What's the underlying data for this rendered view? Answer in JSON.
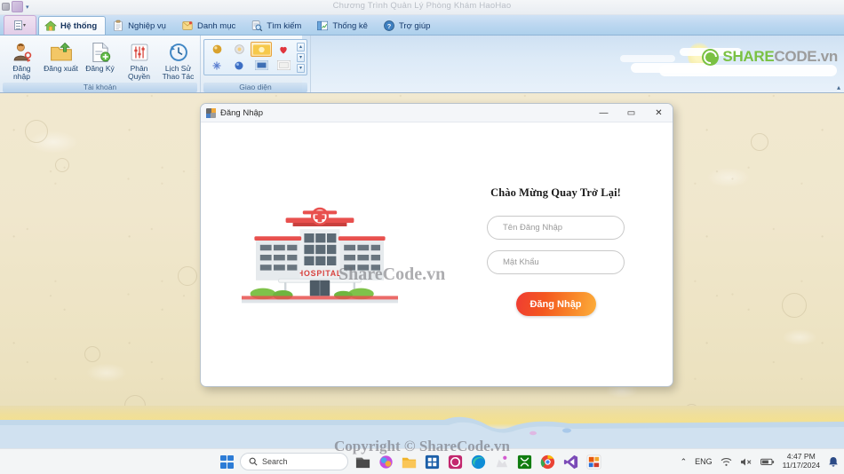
{
  "window": {
    "title": "Chương Trình Quản Lý Phòng Khám HaoHao",
    "quick_access": [
      "save-icon",
      "undo-icon",
      "customize-caret"
    ]
  },
  "ribbon": {
    "app_button": "file-menu-button",
    "tabs": [
      {
        "label": "Hệ thống",
        "icon": "home-icon",
        "active": true
      },
      {
        "label": "Nghiệp vụ",
        "icon": "clipboard-icon",
        "active": false
      },
      {
        "label": "Danh  mục",
        "icon": "notes-icon",
        "active": false
      },
      {
        "label": "Tìm kiếm",
        "icon": "magnifier-icon",
        "active": false
      },
      {
        "label": "Thống kê",
        "icon": "chart-book-icon",
        "active": false
      },
      {
        "label": "Trợ giúp",
        "icon": "help-icon",
        "active": false
      }
    ],
    "groups": [
      {
        "label": "Tài khoản",
        "buttons": [
          {
            "label": "Đăng nhập",
            "icon": "user-key-icon"
          },
          {
            "label": "Đăng xuất",
            "icon": "folder-out-icon"
          },
          {
            "label": "Đăng Ký",
            "icon": "page-add-icon"
          },
          {
            "label": "Phân Quyền",
            "icon": "permissions-icon"
          },
          {
            "label": "Lịch Sử\nThao Tác",
            "icon": "history-icon"
          }
        ]
      },
      {
        "label": "Giao diện",
        "swatches": [
          {
            "name": "theme-amber-sphere",
            "selected": false
          },
          {
            "name": "theme-grey-flower",
            "selected": false
          },
          {
            "name": "theme-gold-bar",
            "selected": true
          },
          {
            "name": "theme-red-heart",
            "selected": false
          },
          {
            "name": "theme-blue-snow",
            "selected": false
          },
          {
            "name": "theme-blue-sphere",
            "selected": false
          },
          {
            "name": "theme-blue-square",
            "selected": false
          },
          {
            "name": "theme-white-frame",
            "selected": false
          }
        ],
        "scroll_up": "▴",
        "scroll_down": "▾",
        "scroll_more": "▾"
      }
    ],
    "collapse_icon": "▴",
    "brand": {
      "mark": "sharecode-logo-icon",
      "part_a": "SHARE",
      "part_b": "CODE.vn"
    }
  },
  "dialog": {
    "title": "Đăng Nhập",
    "icon": "app-window-icon",
    "controls": {
      "minimize": "—",
      "maximize": "▭",
      "close": "✕"
    },
    "illustration": "hospital-building-icon",
    "welcome": "Chào Mừng Quay Trở Lại!",
    "username": {
      "placeholder": "Tên Đăng Nhập",
      "value": "",
      "icon": "user-icon"
    },
    "password": {
      "placeholder": "Mật Khẩu",
      "value": "",
      "icon": "lock-icon"
    },
    "submit_label": "Đăng Nhập",
    "watermark": "ShareCode.vn"
  },
  "taskbar": {
    "start": "windows-start-icon",
    "search_placeholder": "Search",
    "search_icon": "search-icon",
    "apps": [
      {
        "name": "file-explorer-icon",
        "color": "#4a4a4a"
      },
      {
        "name": "copilot-icon",
        "color": "#c44de0"
      },
      {
        "name": "folder-icon",
        "color": "#f0b429"
      },
      {
        "name": "store-icon",
        "color": "#1b5fa8"
      },
      {
        "name": "access-icon",
        "color": "#a4373a"
      },
      {
        "name": "edge-icon",
        "color": "#0f8dd6"
      },
      {
        "name": "sketch-icon",
        "color": "#e8e8e8"
      },
      {
        "name": "xbox-icon",
        "color": "#107c10"
      },
      {
        "name": "chrome-icon",
        "color": "#ea4335"
      },
      {
        "name": "visual-studio-icon",
        "color": "#7b4bb7"
      },
      {
        "name": "office-icon",
        "color": "#d83b01"
      }
    ],
    "tray": {
      "chevron": "⌃",
      "language": "ENG",
      "wifi": "wifi-icon",
      "volume": "volume-muted-icon",
      "battery": "battery-icon",
      "time": "4:47 PM",
      "date": "11/17/2024",
      "notifications": "bell-icon"
    },
    "watermark": "Copyright © ShareCode.vn"
  }
}
